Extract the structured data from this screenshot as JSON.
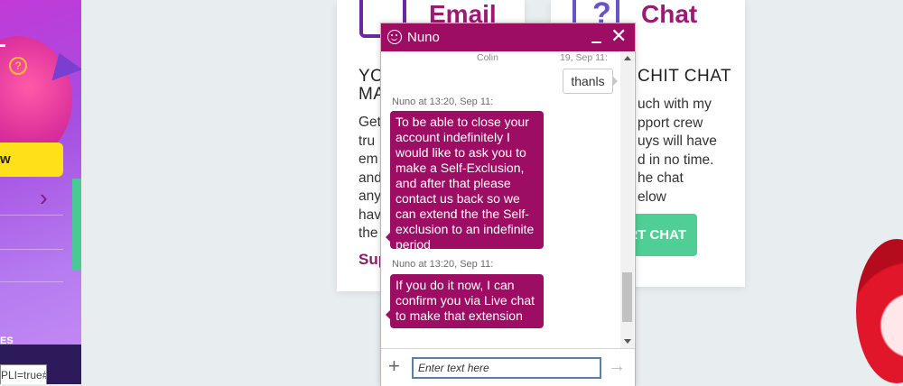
{
  "left": {
    "help_glyph": "?",
    "yellow_button_fragment": "w",
    "chevron": "›",
    "bottom_fragment": "ES",
    "url_fragment": "PLI=true#"
  },
  "email_card": {
    "title": "Email",
    "heading_line1": "YO",
    "heading_line2": "MA",
    "body": "Get\ntru\nem\nand\nany\nhav\nthe",
    "link": "Sup"
  },
  "chat_card": {
    "title": "Chat",
    "icon": "?",
    "heading": "CHIT CHAT",
    "body": "uch with my\npport crew\nuys will have\nd in no time.\nhe chat\nelow",
    "button": "RT CHAT"
  },
  "chat_widget": {
    "agent_name": "Nuno",
    "prev_sender": "Colin",
    "prev_date": "19, Sep 11:",
    "user_message": "thanls",
    "messages": [
      {
        "meta": "Nuno at 13:20, Sep 11:",
        "text": "To be able to close your account indefinitely I would like to ask you to make a Self-Exclusion, and after that please contact us back so we can extend the the Self-exclusion to an indefinite period"
      },
      {
        "meta": "Nuno at 13:20, Sep 11:",
        "text": "If you do it now, I can confirm you via Live chat to make that extension"
      }
    ],
    "input_placeholder": "Enter text here",
    "close_glyph": "✕",
    "plus_glyph": "+",
    "send_glyph": "→"
  },
  "colors": {
    "brand": "#9c0d63",
    "green": "#4fcf95",
    "purple": "#a64ee0"
  }
}
